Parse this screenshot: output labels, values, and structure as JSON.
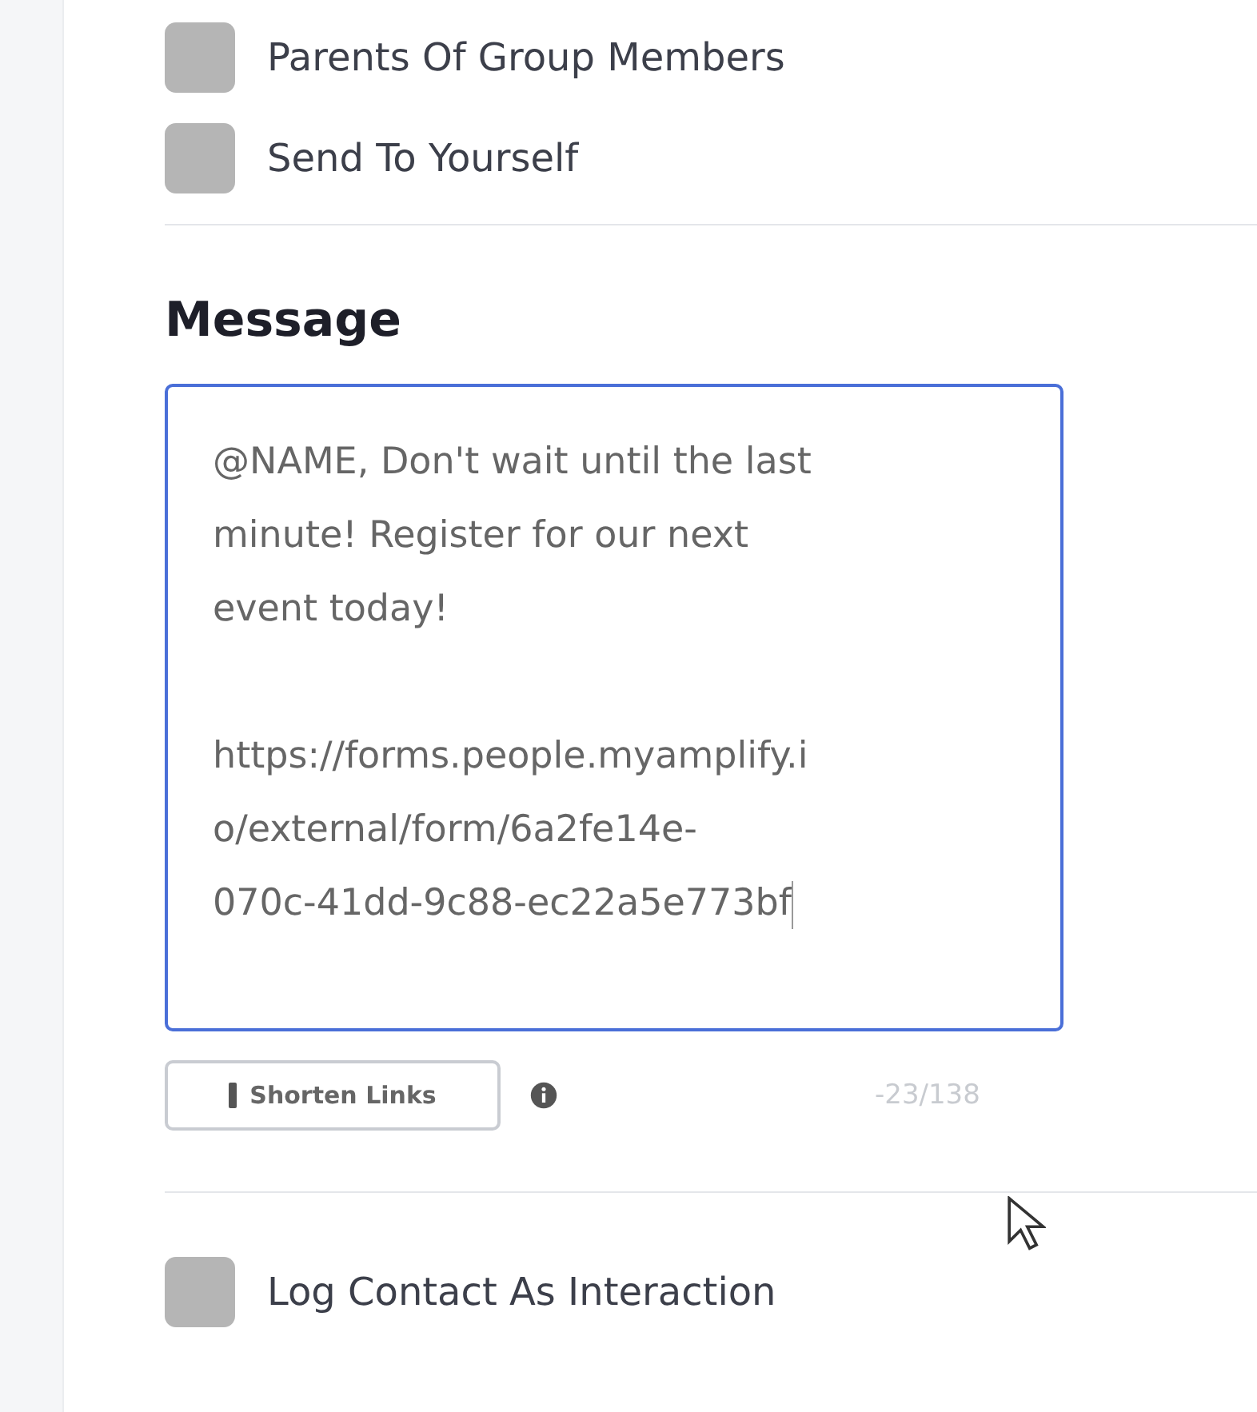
{
  "recipients": [
    {
      "label": "Parents Of Group Members",
      "checked": false
    },
    {
      "label": "Send To Yourself",
      "checked": false
    }
  ],
  "message": {
    "heading": "Message",
    "focused": true,
    "paragraphs": [
      [
        "@NAME, Don't wait until the last",
        "minute! Register for our next",
        "event today!"
      ],
      [
        "https://forms.people.myamplify.i",
        "o/external/form/6a2fe14e-",
        "070c-41dd-9c88-ec22a5e773bf"
      ]
    ],
    "shorten_button": "Shorten Links",
    "counter": "-23/138"
  },
  "options": [
    {
      "label": "Log Contact As Interaction",
      "checked": false
    }
  ]
}
